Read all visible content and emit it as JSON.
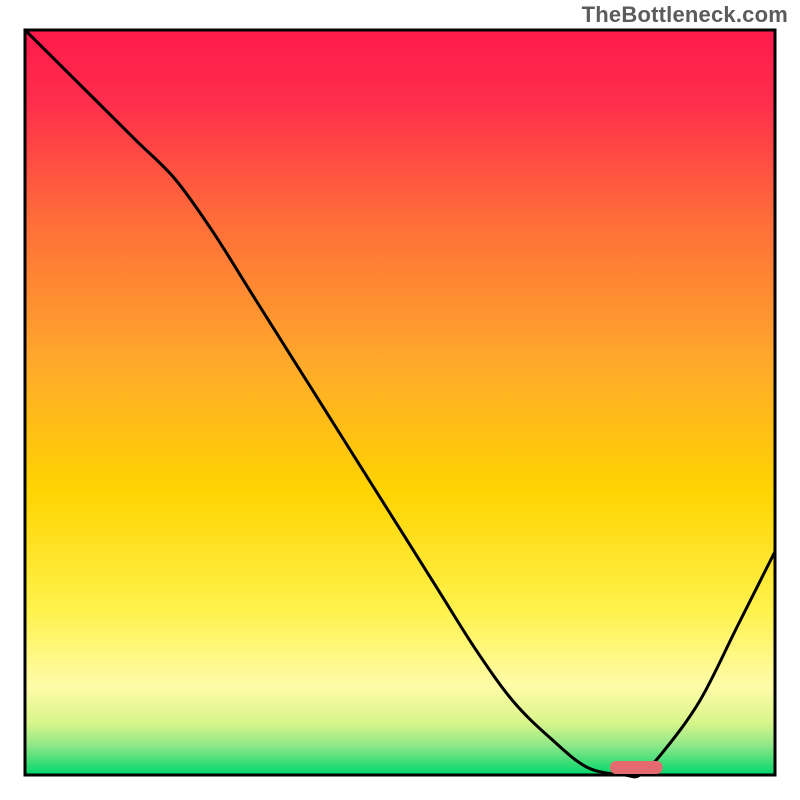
{
  "watermark": "TheBottleneck.com",
  "chart_data": {
    "type": "line",
    "title": "",
    "xlabel": "",
    "ylabel": "",
    "xlim": [
      0,
      100
    ],
    "ylim": [
      0,
      100
    ],
    "x": [
      0,
      5,
      10,
      15,
      20,
      25,
      30,
      35,
      40,
      45,
      50,
      55,
      60,
      65,
      70,
      75,
      80,
      82,
      85,
      90,
      95,
      100
    ],
    "values": [
      100,
      95,
      90,
      85,
      80,
      73,
      65,
      57,
      49,
      41,
      33,
      25,
      17,
      10,
      5,
      1,
      0,
      0,
      3,
      10,
      20,
      30
    ],
    "marker": {
      "x_start": 78,
      "x_end": 85,
      "y": 1
    },
    "note": "x/y are relative 0-100; no axis ticks or labels are visible in the image; values estimated from curve position against the gradient background"
  },
  "colors": {
    "gradient_top": "#ff1a4b",
    "gradient_mid": "#ffd400",
    "gradient_yellow": "#fff46a",
    "gradient_green": "#00d66b",
    "curve": "#000000",
    "marker": "#e46a6f",
    "border": "#000000"
  }
}
